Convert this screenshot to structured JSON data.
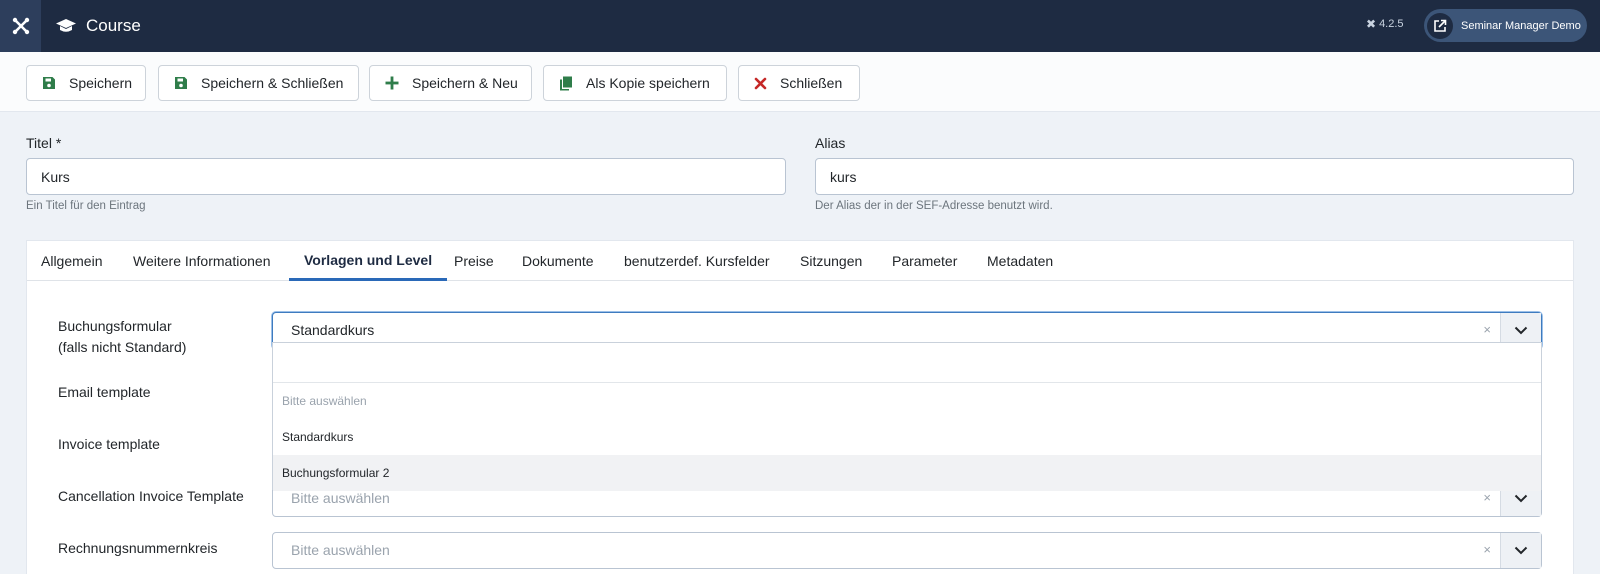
{
  "header": {
    "title": "Course",
    "version": "4.2.5",
    "site_button": "Seminar Manager Demo"
  },
  "toolbar": {
    "save": "Speichern",
    "save_close": "Speichern & Schließen",
    "save_new": "Speichern & Neu",
    "save_copy": "Als Kopie speichern",
    "close": "Schließen"
  },
  "form": {
    "title_label": "Titel *",
    "title_value": "Kurs",
    "title_hint": "Ein Titel für den Eintrag",
    "alias_label": "Alias",
    "alias_value": "kurs",
    "alias_hint": "Der Alias der in der SEF-Adresse benutzt wird."
  },
  "tabs": [
    {
      "label": "Allgemein"
    },
    {
      "label": "Weitere Informationen"
    },
    {
      "label": "Vorlagen und Level",
      "active": true
    },
    {
      "label": "Preise"
    },
    {
      "label": "Dokumente"
    },
    {
      "label": "benutzerdef. Kursfelder"
    },
    {
      "label": "Sitzungen"
    },
    {
      "label": "Parameter"
    },
    {
      "label": "Metadaten"
    }
  ],
  "fields": {
    "booking_form_label_1": "Buchungsformular",
    "booking_form_label_2": "(falls nicht Standard)",
    "booking_form_value": "Standardkurs",
    "email_template_label": "Email template",
    "invoice_template_label": "Invoice template",
    "cancellation_label": "Cancellation Invoice Template",
    "cancellation_value": "Bitte auswählen",
    "invoice_number_label": "Rechnungsnummernkreis",
    "invoice_number_value": "Bitte auswählen",
    "clear_symbol": "×"
  },
  "dropdown": {
    "options": [
      "Bitte auswählen",
      "Standardkurs",
      "Buchungsformular 2"
    ],
    "highlighted_index": 2
  },
  "colors": {
    "header_bg": "#1e2b42",
    "accent": "#2a69b8",
    "save_green": "#2f7d4a",
    "close_red": "#c52827"
  }
}
